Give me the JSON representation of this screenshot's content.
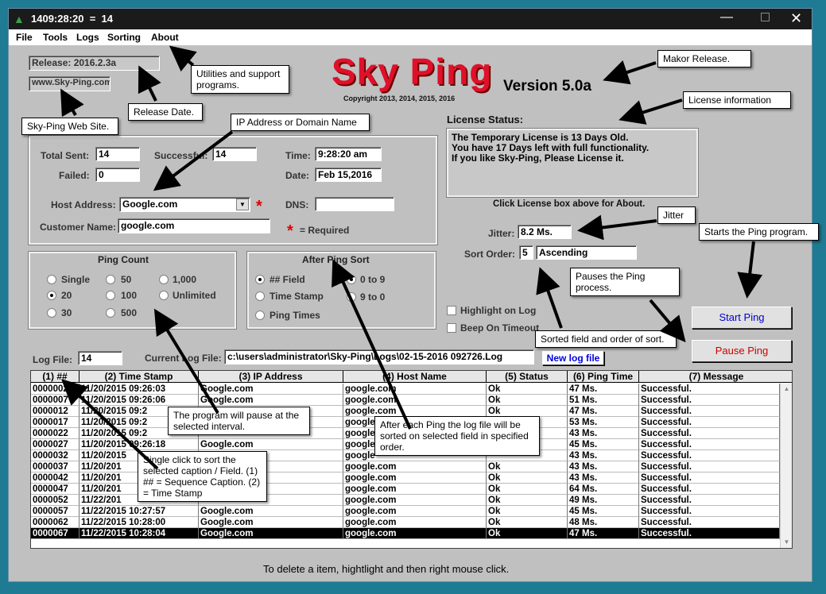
{
  "window": {
    "title": "1409:28:20  =  14"
  },
  "menu": [
    "File",
    "Tools",
    "Logs",
    "Sorting",
    "About"
  ],
  "release": "Release:  2016.2.3a",
  "website": "www.Sky-Ping.com",
  "logo": {
    "text": "Sky Ping",
    "version": "Version 5.0a",
    "copyright": "Copyright 2013, 2014, 2015, 2016"
  },
  "license": {
    "title": "License Status:",
    "lines": [
      "The Temporary License is 13 Days Old.",
      "You have 17 Days left with full functionality.",
      "If you like Sky-Ping, Please License it."
    ],
    "hint": "Click License box above for About."
  },
  "form": {
    "total_sent_label": "Total Sent:",
    "total_sent": "14",
    "successful_label": "Successful:",
    "successful": "14",
    "failed_label": "Failed:",
    "failed": "0",
    "time_label": "Time:",
    "time": "9:28:20 am",
    "date_label": "Date:",
    "date": "Feb 15,2016",
    "host_label": "Host Address:",
    "host": "Google.com",
    "dns_label": "DNS:",
    "dns": "",
    "customer_label": "Customer Name:",
    "customer": "google.com",
    "required_star": "*",
    "required_text": "= Required"
  },
  "jitter": {
    "label": "Jitter:",
    "value": "8.2 Ms."
  },
  "sort_order": {
    "label": "Sort Order:",
    "field": "5",
    "order": "Ascending"
  },
  "ping_count": {
    "title": "Ping Count",
    "options": [
      "Single",
      "50",
      "1,000",
      "20",
      "100",
      "Unlimited",
      "30",
      "500"
    ],
    "selected": "20"
  },
  "after_ping_sort": {
    "title": "After Ping Sort",
    "options": [
      "## Field",
      "0 to 9",
      "Time Stamp",
      "9 to 0",
      "Ping Times"
    ],
    "selected": [
      "## Field",
      "0 to 9"
    ]
  },
  "checkboxes": [
    "Highlight on Log",
    "Beep On Timeout"
  ],
  "buttons": {
    "start": "Start Ping",
    "pause": "Pause Ping",
    "new_log": "New log file"
  },
  "log": {
    "log_file_label": "Log File:",
    "log_file": "14",
    "current_label": "Current Log File:",
    "current": "c:\\users\\administrator\\Sky-Ping\\Logs\\02-15-2016  092726.Log"
  },
  "table": {
    "columns": [
      "(1) ##",
      "(2) Time Stamp",
      "(3) IP Address",
      "(4) Host Name",
      "(5) Status",
      "(6) Ping Time",
      "(7) Message"
    ],
    "rows": [
      [
        "0000002",
        "11/20/2015  09:26:03",
        "Google.com",
        "google.com",
        "Ok",
        "47 Ms.",
        "Successful."
      ],
      [
        "0000007",
        "11/20/2015  09:26:06",
        "Google.com",
        "google.com",
        "Ok",
        "51 Ms.",
        "Successful."
      ],
      [
        "0000012",
        "11/20/2015  09:2",
        "",
        "google.com",
        "Ok",
        "47 Ms.",
        "Successful."
      ],
      [
        "0000017",
        "11/20/2015  09:2",
        "",
        "google",
        "",
        "53 Ms.",
        "Successful."
      ],
      [
        "0000022",
        "11/20/2015  09:2",
        "",
        "google",
        "",
        "43 Ms.",
        "Successful."
      ],
      [
        "0000027",
        "11/20/2015  09:26:18",
        "Google.com",
        "google",
        "",
        "45 Ms.",
        "Successful."
      ],
      [
        "0000032",
        "11/20/2015",
        "",
        "google",
        "",
        "43 Ms.",
        "Successful."
      ],
      [
        "0000037",
        "11/20/201",
        "",
        "google.com",
        "Ok",
        "43 Ms.",
        "Successful."
      ],
      [
        "0000042",
        "11/20/201",
        "",
        "google.com",
        "Ok",
        "43 Ms.",
        "Successful."
      ],
      [
        "0000047",
        "11/20/201",
        "",
        "google.com",
        "Ok",
        "64 Ms.",
        "Successful."
      ],
      [
        "0000052",
        "11/22/201",
        "",
        "google.com",
        "Ok",
        "49 Ms.",
        "Successful."
      ],
      [
        "0000057",
        "11/22/2015  10:27:57",
        "Google.com",
        "google.com",
        "Ok",
        "45 Ms.",
        "Successful."
      ],
      [
        "0000062",
        "11/22/2015  10:28:00",
        "Google.com",
        "google.com",
        "Ok",
        "48 Ms.",
        "Successful."
      ],
      [
        "0000067",
        "11/22/2015  10:28:04",
        "Google.com",
        "google.com",
        "Ok",
        "47 Ms.",
        "Successful."
      ]
    ]
  },
  "footer": "To delete a item, hightlight and then right mouse click.",
  "callouts": {
    "utilities": "Utilities and support programs.",
    "makor": "Makor Release.",
    "release_date": "Release Date.",
    "license_info": "License information",
    "website": "Sky-Ping Web Site.",
    "ip_domain": "IP Address or Domain Name",
    "jitter": "Jitter",
    "starts": "Starts the Ping program.",
    "pauses": "Pauses the Ping process.",
    "sorted": "Sorted field and order of sort.",
    "pause_interval": "The program will pause at the selected interval.",
    "after_each": "After each Ping the log file will be sorted on selected field in specified order.",
    "single_click": "Single click to sort the selected caption / Field. (1) ## = Sequence Caption. (2) = Time Stamp"
  },
  "colors": {
    "logo_red": "#e0102a",
    "start_blue": "#0000cc",
    "pause_red": "#cc0000",
    "required_red": "#e00000",
    "new_log_blue": "#0000e0"
  }
}
